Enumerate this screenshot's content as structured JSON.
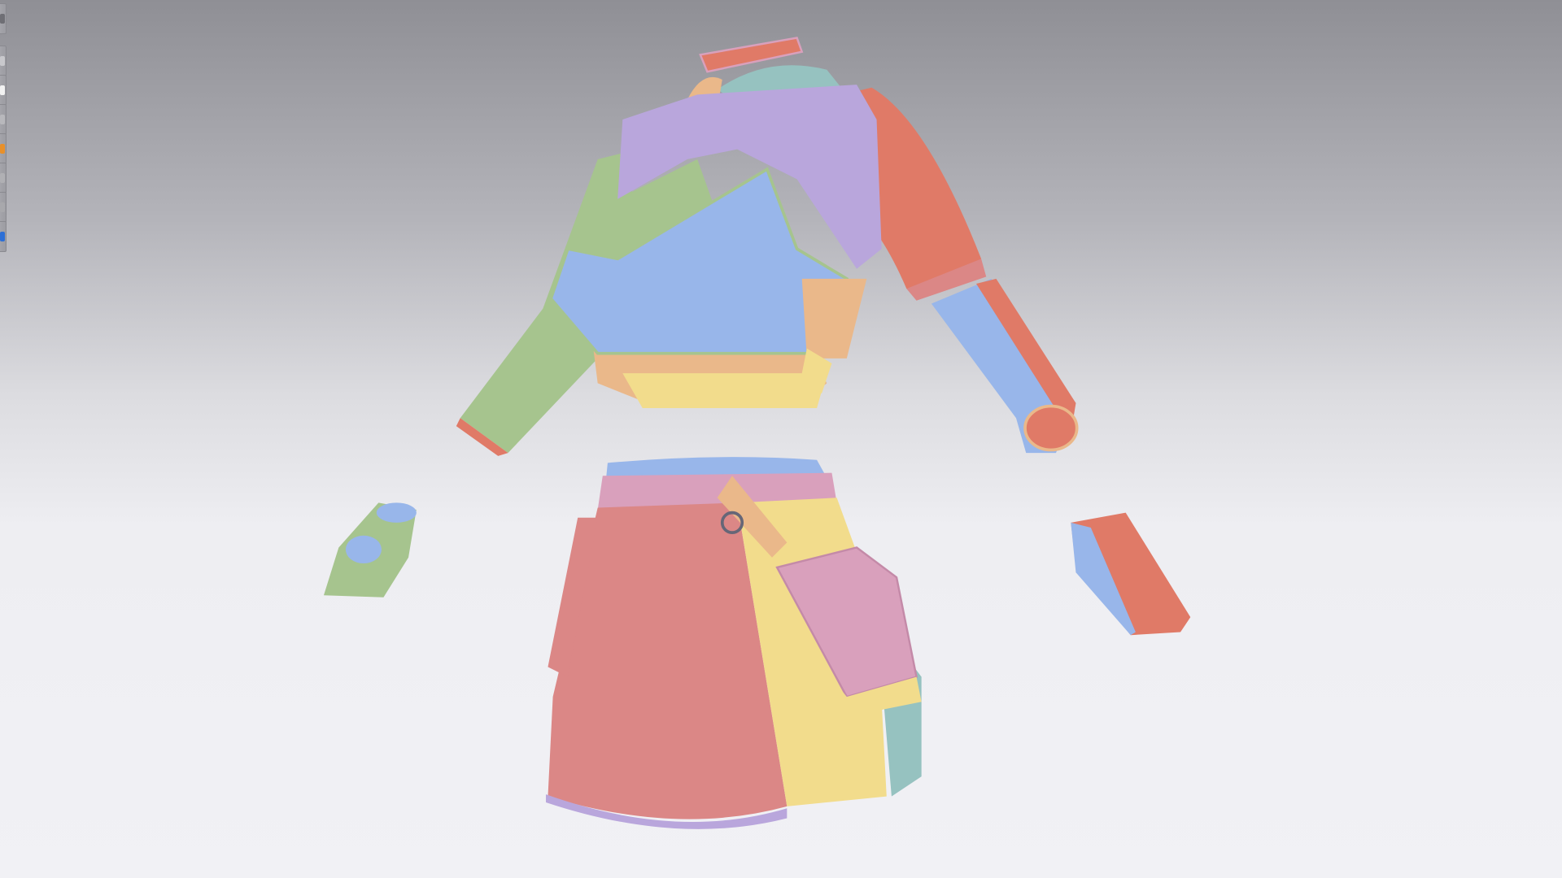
{
  "toolbar": {
    "tools": [
      {
        "icon": "avatar-icon",
        "color": "#6f6f75"
      },
      {
        "icon": "garment-icon",
        "color": "#c8c8cc"
      },
      {
        "icon": "texture-icon",
        "color": "#f2f2f2"
      },
      {
        "icon": "pin-icon",
        "color": "#b8b8bc"
      },
      {
        "icon": "color-palette-icon",
        "color": "#e8902a"
      },
      {
        "icon": "brush-icon",
        "color": "#b0b0b4"
      },
      {
        "icon": "ruler-icon",
        "color": "#a8a8ac"
      },
      {
        "icon": "globe-icon",
        "color": "#2d6fd6"
      }
    ]
  },
  "viewport": {
    "garment_colors": {
      "red": "#e07a67",
      "lavender": "#b9a6dc",
      "blue": "#98b6ea",
      "green": "#a6c48e",
      "yellow": "#f2dc8c",
      "orange": "#eab88a",
      "pink": "#d9a0bc",
      "rose": "#db8786",
      "teal": "#96c2c0"
    },
    "pieces": {
      "left_glove": {
        "side": "left",
        "colors": [
          "green",
          "blue"
        ]
      },
      "right_glove": {
        "side": "right",
        "colors": [
          "red",
          "blue"
        ]
      }
    }
  }
}
